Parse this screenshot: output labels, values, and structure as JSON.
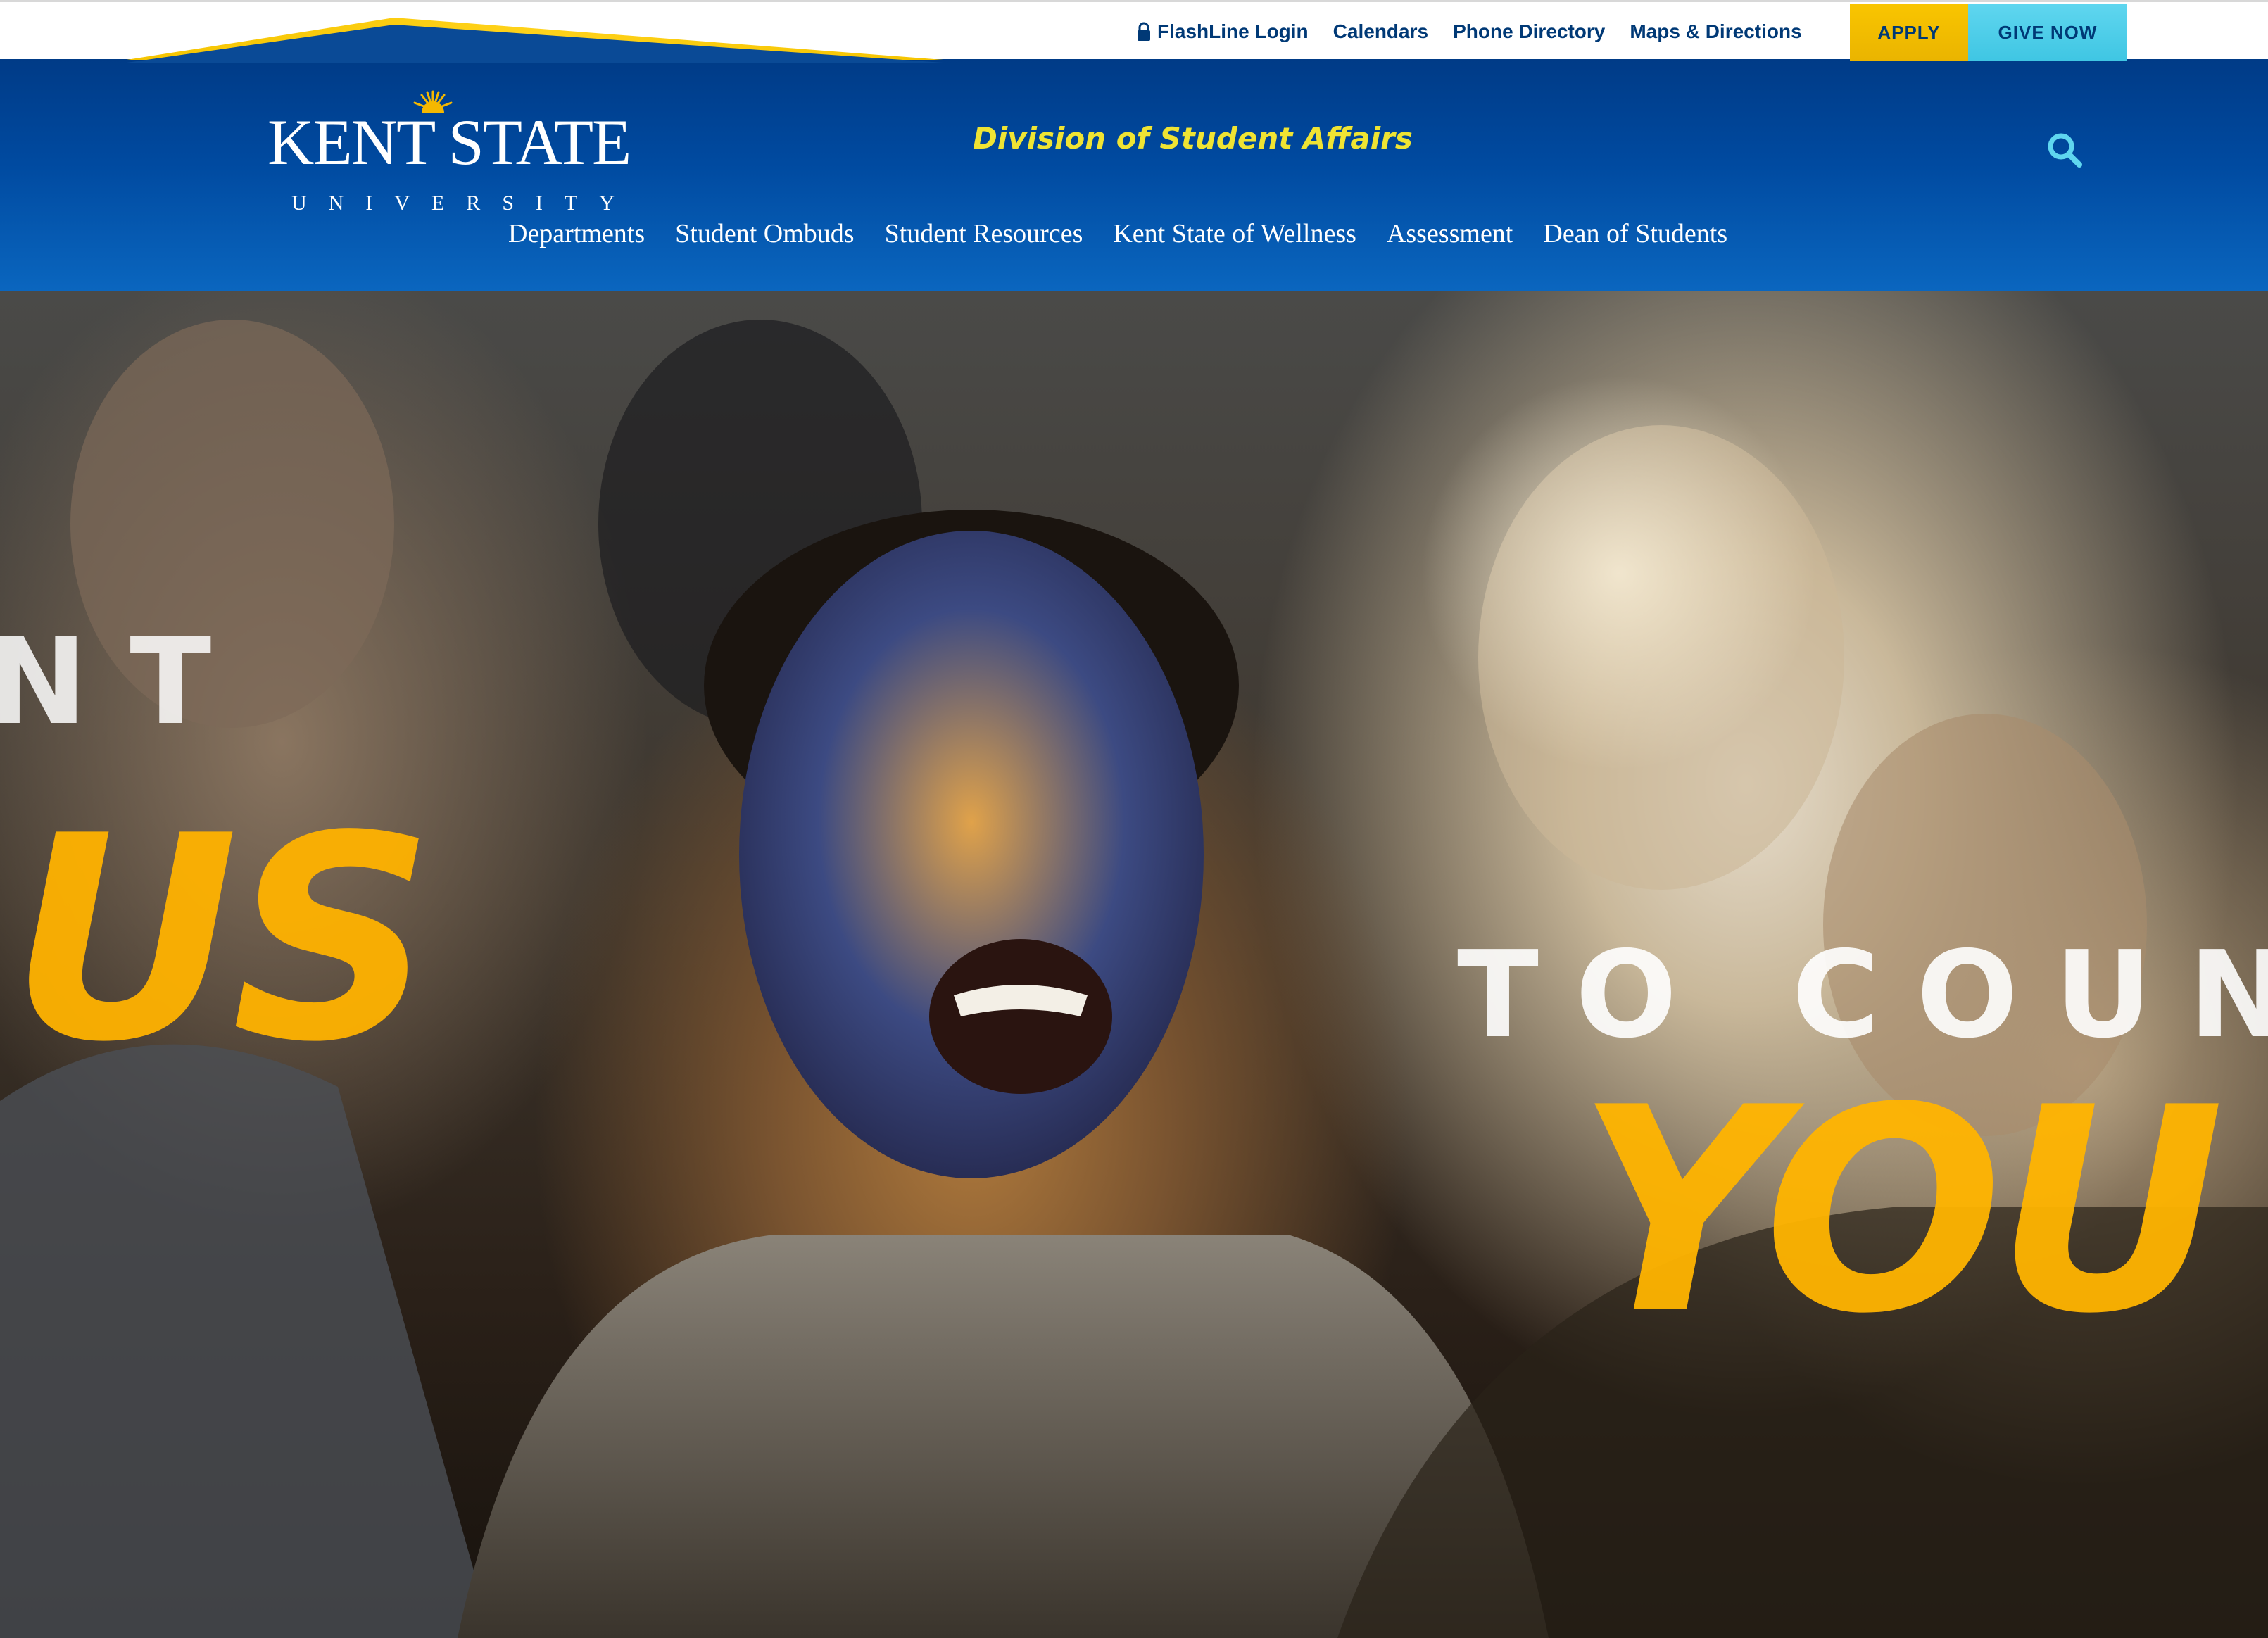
{
  "utility": {
    "links": [
      {
        "label": "FlashLine Login",
        "icon": "lock-icon"
      },
      {
        "label": "Calendars"
      },
      {
        "label": "Phone Directory"
      },
      {
        "label": "Maps & Directions"
      }
    ],
    "apply_label": "APPLY",
    "give_label": "GIVE NOW"
  },
  "header": {
    "logo_main": "KENT STATE",
    "logo_sub": "UNIVERSITY",
    "division_title": "Division of Student Affairs",
    "search_icon": "search-icon"
  },
  "nav": {
    "items": [
      "Departments",
      "Student Ombuds",
      "Student Resources",
      "Kent State of Wellness",
      "Assessment",
      "Dean of Students"
    ]
  },
  "hero": {
    "line1": "NT",
    "line2": "US",
    "line3": "TO COUN",
    "line4": "YOU"
  },
  "colors": {
    "navy": "#003976",
    "header_blue": "#004aa0",
    "gold": "#f9c500",
    "cyan": "#5fd6ef",
    "division_yellow": "#efe433",
    "search_cyan": "#5fd6ef"
  }
}
